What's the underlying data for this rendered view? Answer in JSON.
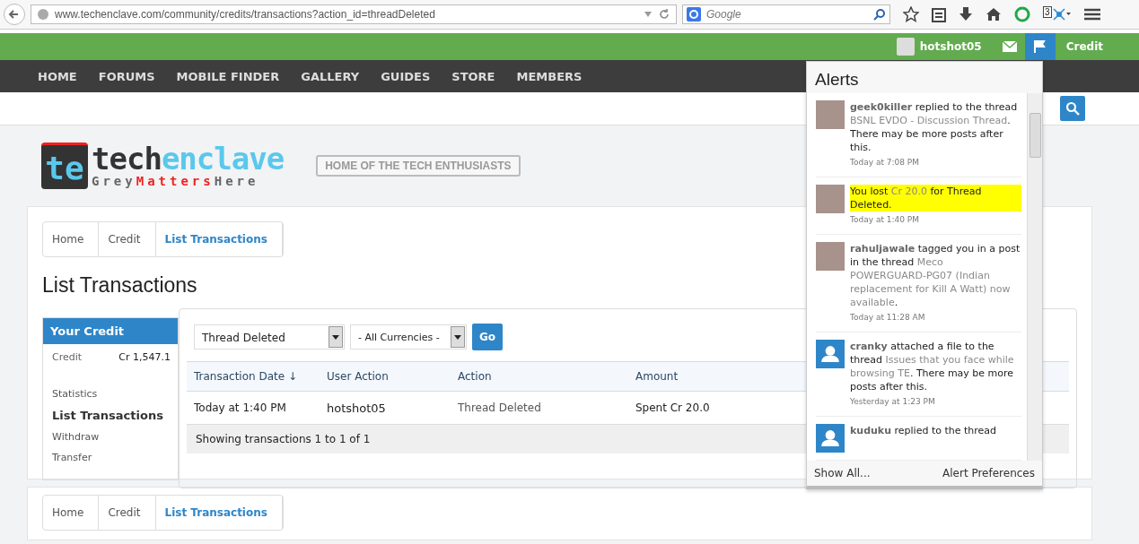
{
  "browser": {
    "url": "www.techenclave.com/community/credits/transactions?action_id=threadDeleted",
    "search_placeholder": "Google",
    "badge": "3"
  },
  "user_bar": {
    "username": "hotshot05",
    "alerts_active": true,
    "credit_link": "Credit"
  },
  "nav": [
    "HOME",
    "FORUMS",
    "MOBILE FINDER",
    "GALLERY",
    "GUIDES",
    "STORE",
    "MEMBERS"
  ],
  "logo": {
    "mark": "te",
    "word_a": "tech",
    "word_b": "enclave",
    "tag_a": "Grey",
    "tag_b": "Matters",
    "tag_c": "Here",
    "slogan": "HOME OF THE TECH ENTHUSIASTS"
  },
  "breadcrumb": [
    {
      "label": "Home",
      "selected": false
    },
    {
      "label": "Credit",
      "selected": false
    },
    {
      "label": "List Transactions",
      "selected": true
    }
  ],
  "title": "List Transactions",
  "sidebar": {
    "heading": "Your Credit",
    "credit_label": "Credit",
    "credit_value": "Cr 1,547.1",
    "items": [
      {
        "label": "Statistics",
        "selected": false
      },
      {
        "label": "List Transactions",
        "selected": true
      },
      {
        "label": "Withdraw",
        "selected": false
      },
      {
        "label": "Transfer",
        "selected": false
      }
    ]
  },
  "filters": {
    "action": "Thread Deleted",
    "currency": "- All Currencies -",
    "button": "Go"
  },
  "table": {
    "columns": [
      "Transaction Date ↓",
      "User Action",
      "Action",
      "Amount"
    ],
    "rows": [
      [
        "Today at 1:40 PM",
        "hotshot05",
        "Thread Deleted",
        "Spent Cr 20.0"
      ]
    ],
    "footer": "Showing transactions 1 to 1 of 1"
  },
  "breadcrumb_bottom": [
    {
      "label": "Home",
      "selected": false
    },
    {
      "label": "Credit",
      "selected": false
    },
    {
      "label": "List Transactions",
      "selected": true
    }
  ],
  "alerts": {
    "title": "Alerts",
    "show_all": "Show All...",
    "preferences": "Alert Preferences",
    "items": [
      {
        "kind": "photo",
        "highlighted": false,
        "parts": [
          {
            "kind": "user",
            "text": "geek0killer"
          },
          {
            "kind": "plain",
            "text": " replied to the thread "
          },
          {
            "kind": "link",
            "text": "BSNL EVDO - Discussion Thread"
          },
          {
            "kind": "plain",
            "text": ". There may be more posts after this."
          }
        ],
        "time": "Today at 7:08 PM"
      },
      {
        "kind": "photo",
        "highlighted": true,
        "parts": [
          {
            "kind": "plain",
            "text": "You lost "
          },
          {
            "kind": "link",
            "text": "Cr 20.0"
          },
          {
            "kind": "plain",
            "text": " for Thread Deleted."
          }
        ],
        "time": "Today at 1:40 PM"
      },
      {
        "kind": "photo",
        "highlighted": false,
        "parts": [
          {
            "kind": "user",
            "text": "rahuljawale"
          },
          {
            "kind": "plain",
            "text": " tagged you in a post in the thread "
          },
          {
            "kind": "link",
            "text": "Meco POWERGUARD-PG07 (Indian replacement for Kill A Watt) now available"
          },
          {
            "kind": "plain",
            "text": "."
          }
        ],
        "time": "Today at 11:28 AM"
      },
      {
        "kind": "default",
        "highlighted": false,
        "parts": [
          {
            "kind": "user",
            "text": "cranky"
          },
          {
            "kind": "plain",
            "text": " attached a file to the thread "
          },
          {
            "kind": "link",
            "text": "Issues that you face while browsing TE"
          },
          {
            "kind": "plain",
            "text": ". There may be more posts after this."
          }
        ],
        "time": "Yesterday at 1:23 PM"
      },
      {
        "kind": "default",
        "highlighted": false,
        "parts": [
          {
            "kind": "user",
            "text": "kuduku"
          },
          {
            "kind": "plain",
            "text": " replied to the thread"
          }
        ]
      }
    ]
  }
}
